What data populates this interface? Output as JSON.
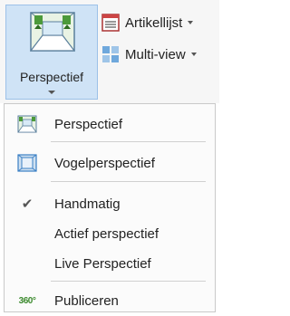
{
  "ribbon": {
    "big_button": {
      "label": "Perspectief",
      "icon": "perspective-icon"
    },
    "small_buttons": [
      {
        "label": "Artikellijst",
        "icon": "article-list-icon",
        "has_dropdown": true
      },
      {
        "label": "Multi-view",
        "icon": "multi-view-icon",
        "has_dropdown": true
      }
    ]
  },
  "menu": {
    "items": [
      {
        "label": "Perspectief",
        "icon": "perspective-icon"
      },
      {
        "label": "Vogelperspectief",
        "icon": "birds-eye-view-icon"
      },
      {
        "label": "Handmatig",
        "icon": "checkmark-icon",
        "checked": true
      },
      {
        "label": "Actief perspectief",
        "icon": ""
      },
      {
        "label": "Live Perspectief",
        "icon": ""
      },
      {
        "label": "Publiceren",
        "icon": "publish-360-icon",
        "badge": "360°"
      }
    ]
  },
  "colors": {
    "selected_bg": "#cfe3f6",
    "selected_border": "#9cc1e8",
    "menu_bg": "#fbfbfb",
    "separator": "#d0d0d0",
    "icon_green": "#3c8a2e",
    "icon_blue": "#3a7fc4"
  }
}
